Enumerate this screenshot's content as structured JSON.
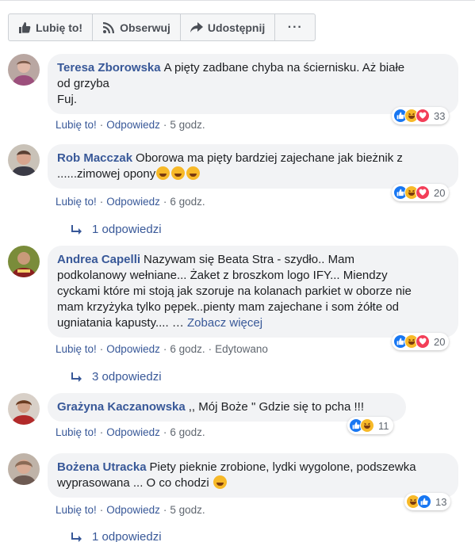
{
  "toolbar": {
    "like_label": "Lubię to!",
    "follow_label": "Obserwuj",
    "share_label": "Udostępnij",
    "more_label": "···"
  },
  "actions": {
    "like": "Lubię to!",
    "reply": "Odpowiedz",
    "edited": "Edytowano"
  },
  "comments": [
    {
      "author": "Teresa Zborowska",
      "text_line1": "A pięty zadbane chyba na ściernisku. Aż białe",
      "text_line2": "od grzyba",
      "text_line3": "Fuj.",
      "time": "5 godz.",
      "reaction_count": "33",
      "reaction_icons": [
        "like-icon",
        "haha-icon",
        "love-icon"
      ]
    },
    {
      "author": "Rob Macczak",
      "text_line1": "Oborowa ma pięty bardziej zajechane jak bieżnik z",
      "text_line2": "......zimowej opony",
      "time": "6 godz.",
      "reaction_count": "20",
      "reaction_icons": [
        "like-icon",
        "haha-icon",
        "love-icon"
      ],
      "replies": "1 odpowiedzi"
    },
    {
      "author": "Andrea Capelli",
      "text_line1": "Nazywam się Beata Stra - szydło.. Mam",
      "text_line2": "podkolanowy wełniane... Żaket z broszkom logo IFY... Miendzy",
      "text_line3": "cyckami które mi stoją jak szoruje na kolanach parkiet w oborze nie",
      "text_line4": "mam krzyżyka tylko pępek..pienty mam zajechane i som żółte od",
      "text_line5": "ugniatania kapusty.... …",
      "see_more": "Zobacz więcej",
      "time": "6 godz.",
      "reaction_count": "20",
      "reaction_icons": [
        "like-icon",
        "haha-icon",
        "love-icon"
      ],
      "replies": "3 odpowiedzi"
    },
    {
      "author": "Grażyna Kaczanowska",
      "text_line1": ",, Mój Boże \" Gdzie się to pcha !!!",
      "time": "6 godz.",
      "reaction_count": "11",
      "reaction_icons": [
        "like-icon",
        "haha-icon"
      ]
    },
    {
      "author": "Bożena Utracka",
      "text_line1": "Piety pieknie zrobione, lydki wygolone, podszewka",
      "text_line2": "wyprasowana ... O co chodzi",
      "time": "5 godz.",
      "reaction_count": "13",
      "reaction_icons": [
        "haha-icon",
        "like-icon"
      ],
      "replies": "1 odpowiedzi"
    }
  ],
  "colors": {
    "link": "#385898",
    "meta": "#606770",
    "bubble": "#f2f3f5",
    "like": "#1877f2",
    "haha": "#f7b928",
    "love": "#f33e58"
  }
}
